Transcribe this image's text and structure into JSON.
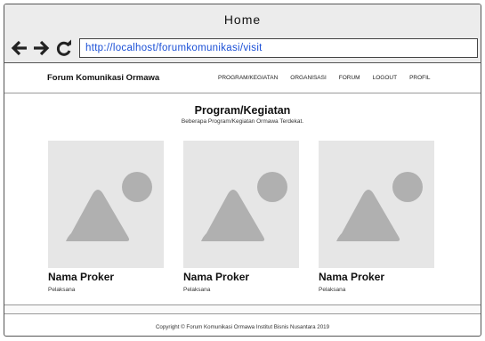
{
  "window": {
    "title": "Home"
  },
  "address_bar": {
    "url": "http://localhost/forumkomunikasi/visit"
  },
  "navbar": {
    "brand": "Forum Komunikasi Ormawa",
    "menu": [
      "PROGRAM/KEGIATAN",
      "ORGANISASI",
      "FORUM",
      "LOGOUT",
      "PROFIL"
    ]
  },
  "section": {
    "title": "Program/Kegiatan",
    "subtitle": "Beberapa Program/Kegiatan Ormawa Terdekat."
  },
  "cards": [
    {
      "title": "Nama Proker",
      "meta": "Pelaksana",
      "image_icon": "image-placeholder-icon"
    },
    {
      "title": "Nama Proker",
      "meta": "Pelaksana",
      "image_icon": "image-placeholder-icon"
    },
    {
      "title": "Nama Proker",
      "meta": "Pelaksana",
      "image_icon": "image-placeholder-icon"
    }
  ],
  "footer": {
    "copyright": "Copyright © Forum Komunikasi Ormawa Institut Bisnis Nusantara 2019"
  },
  "colors": {
    "url_text": "#1a4fd6",
    "chrome_bg": "#ececec",
    "placeholder_bg": "#e6e6e6",
    "placeholder_shape": "#b0b0b0"
  },
  "icons": {
    "back": "arrow-left-icon",
    "forward": "arrow-right-icon",
    "refresh": "refresh-icon"
  }
}
